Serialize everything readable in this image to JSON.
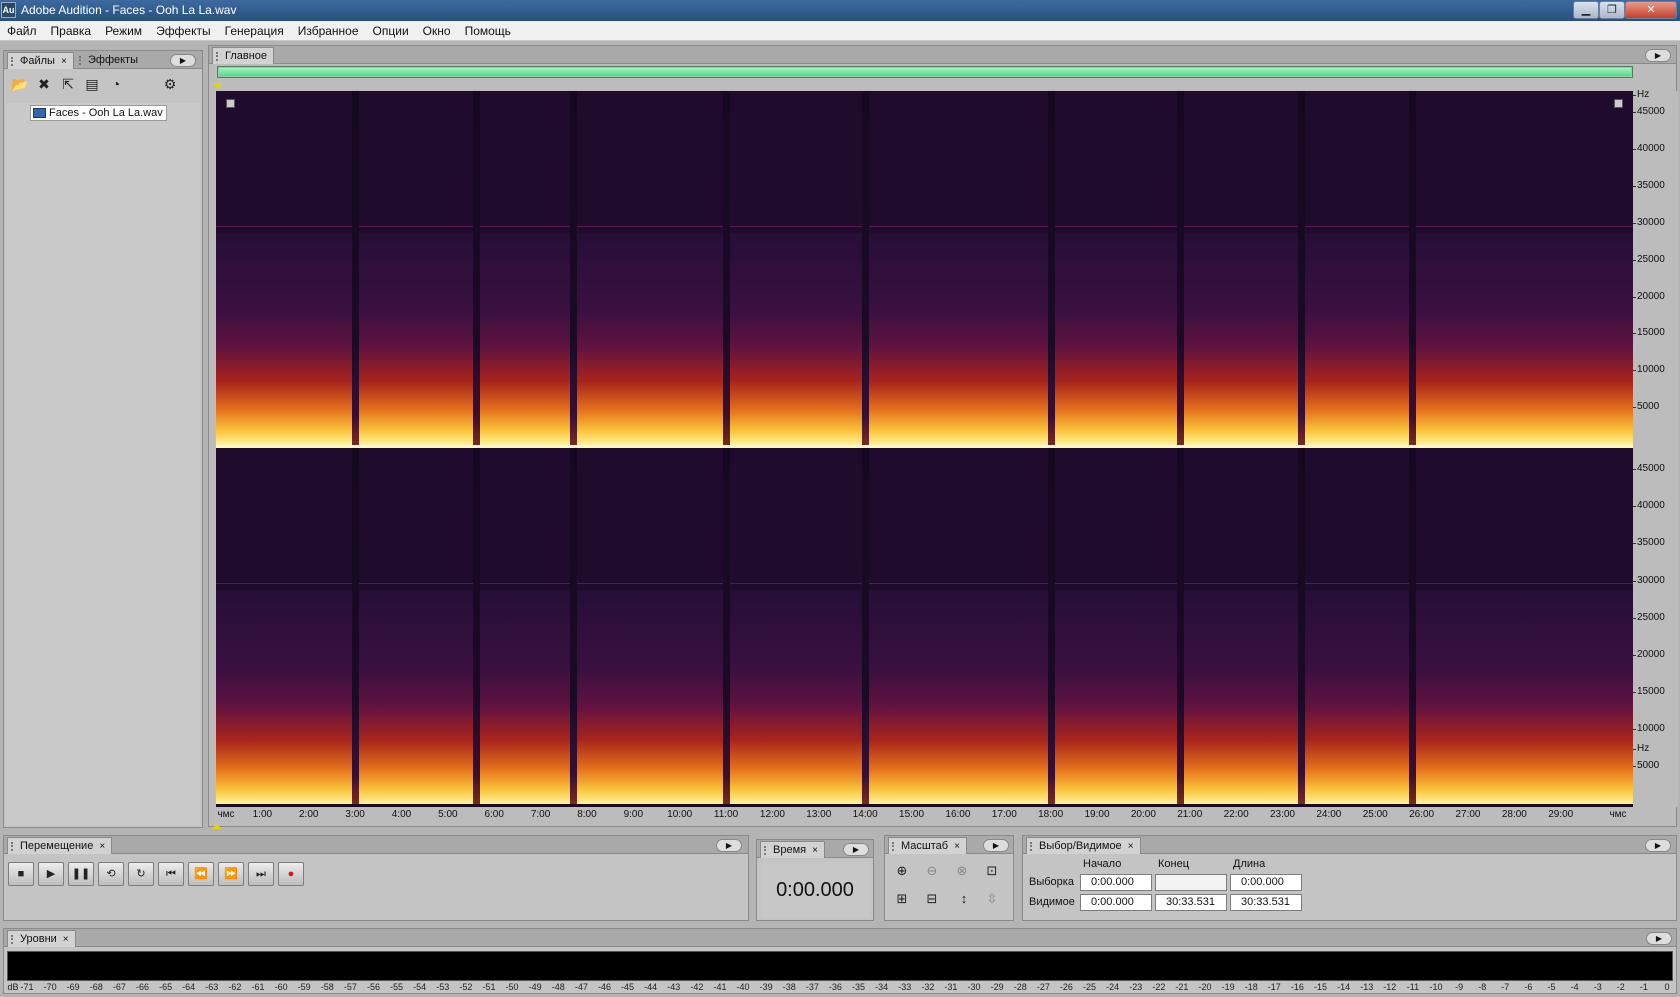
{
  "app": {
    "title": "Adobe Audition - Faces - Ooh La La.wav",
    "icon_label": "Au"
  },
  "window_controls": {
    "minimize": "▁",
    "maximize": "❐",
    "close": "✕"
  },
  "menu": [
    "Файл",
    "Правка",
    "Режим",
    "Эффекты",
    "Генерация",
    "Избранное",
    "Опции",
    "Окно",
    "Помощь"
  ],
  "files_panel": {
    "tabs": [
      "Файлы",
      "Эффекты"
    ],
    "tab_close": "×",
    "files": [
      "Faces - Ooh La La.wav"
    ]
  },
  "main_panel": {
    "tab": "Главное",
    "freq_unit": "Hz",
    "freq_ticks": [
      "45000",
      "40000",
      "35000",
      "30000",
      "25000",
      "20000",
      "15000",
      "10000",
      "5000"
    ],
    "time_start": "чмс",
    "time_end": "чмс",
    "time_ticks": [
      "1:00",
      "2:00",
      "3:00",
      "4:00",
      "5:00",
      "6:00",
      "7:00",
      "8:00",
      "9:00",
      "10:00",
      "11:00",
      "12:00",
      "13:00",
      "14:00",
      "15:00",
      "16:00",
      "17:00",
      "18:00",
      "19:00",
      "20:00",
      "21:00",
      "22:00",
      "23:00",
      "24:00",
      "25:00",
      "26:00",
      "27:00",
      "28:00",
      "29:00"
    ],
    "track_gaps_minutes": [
      3.0,
      5.6,
      7.7,
      11.0,
      14.0,
      18.0,
      20.8,
      23.4,
      25.8
    ]
  },
  "transport_panel": {
    "tab": "Перемещение",
    "buttons": [
      "■",
      "▶",
      "❚❚",
      "⟲",
      "↻",
      "⏮",
      "⏪",
      "⏩",
      "⏭",
      "●"
    ],
    "record_color": "#d81818"
  },
  "time_panel": {
    "tab": "Время",
    "value": "0:00.000"
  },
  "zoom_panel": {
    "tab": "Масштаб"
  },
  "selection_panel": {
    "tab": "Выбор/Видимое",
    "col_start": "Начало",
    "col_end": "Конец",
    "col_length": "Длина",
    "row_selection": "Выборка",
    "row_view": "Видимое",
    "selection": {
      "start": "0:00.000",
      "end": "",
      "length": "0:00.000"
    },
    "view": {
      "start": "0:00.000",
      "end": "30:33.531",
      "length": "30:33.531"
    }
  },
  "levels_panel": {
    "tab": "Уровни",
    "scale_unit": "dB",
    "scale": [
      "-71",
      "-70",
      "-69",
      "-68",
      "-67",
      "-66",
      "-65",
      "-64",
      "-63",
      "-62",
      "-61",
      "-60",
      "-59",
      "-58",
      "-57",
      "-56",
      "-55",
      "-54",
      "-53",
      "-52",
      "-51",
      "-50",
      "-49",
      "-48",
      "-47",
      "-46",
      "-45",
      "-44",
      "-43",
      "-42",
      "-41",
      "-40",
      "-39",
      "-38",
      "-37",
      "-36",
      "-35",
      "-34",
      "-33",
      "-32",
      "-31",
      "-30",
      "-29",
      "-28",
      "-27",
      "-26",
      "-25",
      "-24",
      "-23",
      "-22",
      "-21",
      "-20",
      "-19",
      "-18",
      "-17",
      "-16",
      "-15",
      "-14",
      "-13",
      "-12",
      "-11",
      "-10",
      "-9",
      "-8",
      "-7",
      "-6",
      "-5",
      "-4",
      "-3",
      "-2",
      "-1",
      "0"
    ]
  },
  "colors": {
    "overview_range": "#4ddc8a",
    "marker": "#e8d200",
    "spectrogram_hot": "#f9c53a",
    "spectrogram_cold": "#1d0b2b"
  }
}
